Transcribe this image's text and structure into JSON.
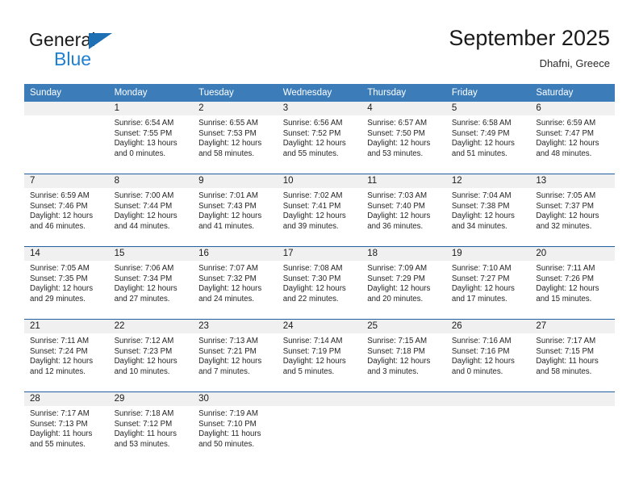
{
  "brand": {
    "name_top": "General",
    "name_bottom": "Blue",
    "triangle_color": "#1f6fb5",
    "blue_text_color": "#1f7fd0"
  },
  "header": {
    "title": "September 2025",
    "location": "Dhafni, Greece"
  },
  "theme": {
    "header_row_bg": "#3b7cb9",
    "grid_line": "#1f5f9e",
    "daynum_band_bg": "#f0f0f0",
    "page_bg": "#ffffff",
    "text": "#222222"
  },
  "weekdays": [
    "Sunday",
    "Monday",
    "Tuesday",
    "Wednesday",
    "Thursday",
    "Friday",
    "Saturday"
  ],
  "labels": {
    "sunrise_prefix": "Sunrise:",
    "sunset_prefix": "Sunset:",
    "daylight_prefix": "Daylight:"
  },
  "weeks": [
    [
      {
        "day": "",
        "lines": []
      },
      {
        "day": "1",
        "lines": [
          "Sunrise: 6:54 AM",
          "Sunset: 7:55 PM",
          "Daylight: 13 hours",
          "and 0 minutes."
        ]
      },
      {
        "day": "2",
        "lines": [
          "Sunrise: 6:55 AM",
          "Sunset: 7:53 PM",
          "Daylight: 12 hours",
          "and 58 minutes."
        ]
      },
      {
        "day": "3",
        "lines": [
          "Sunrise: 6:56 AM",
          "Sunset: 7:52 PM",
          "Daylight: 12 hours",
          "and 55 minutes."
        ]
      },
      {
        "day": "4",
        "lines": [
          "Sunrise: 6:57 AM",
          "Sunset: 7:50 PM",
          "Daylight: 12 hours",
          "and 53 minutes."
        ]
      },
      {
        "day": "5",
        "lines": [
          "Sunrise: 6:58 AM",
          "Sunset: 7:49 PM",
          "Daylight: 12 hours",
          "and 51 minutes."
        ]
      },
      {
        "day": "6",
        "lines": [
          "Sunrise: 6:59 AM",
          "Sunset: 7:47 PM",
          "Daylight: 12 hours",
          "and 48 minutes."
        ]
      }
    ],
    [
      {
        "day": "7",
        "lines": [
          "Sunrise: 6:59 AM",
          "Sunset: 7:46 PM",
          "Daylight: 12 hours",
          "and 46 minutes."
        ]
      },
      {
        "day": "8",
        "lines": [
          "Sunrise: 7:00 AM",
          "Sunset: 7:44 PM",
          "Daylight: 12 hours",
          "and 44 minutes."
        ]
      },
      {
        "day": "9",
        "lines": [
          "Sunrise: 7:01 AM",
          "Sunset: 7:43 PM",
          "Daylight: 12 hours",
          "and 41 minutes."
        ]
      },
      {
        "day": "10",
        "lines": [
          "Sunrise: 7:02 AM",
          "Sunset: 7:41 PM",
          "Daylight: 12 hours",
          "and 39 minutes."
        ]
      },
      {
        "day": "11",
        "lines": [
          "Sunrise: 7:03 AM",
          "Sunset: 7:40 PM",
          "Daylight: 12 hours",
          "and 36 minutes."
        ]
      },
      {
        "day": "12",
        "lines": [
          "Sunrise: 7:04 AM",
          "Sunset: 7:38 PM",
          "Daylight: 12 hours",
          "and 34 minutes."
        ]
      },
      {
        "day": "13",
        "lines": [
          "Sunrise: 7:05 AM",
          "Sunset: 7:37 PM",
          "Daylight: 12 hours",
          "and 32 minutes."
        ]
      }
    ],
    [
      {
        "day": "14",
        "lines": [
          "Sunrise: 7:05 AM",
          "Sunset: 7:35 PM",
          "Daylight: 12 hours",
          "and 29 minutes."
        ]
      },
      {
        "day": "15",
        "lines": [
          "Sunrise: 7:06 AM",
          "Sunset: 7:34 PM",
          "Daylight: 12 hours",
          "and 27 minutes."
        ]
      },
      {
        "day": "16",
        "lines": [
          "Sunrise: 7:07 AM",
          "Sunset: 7:32 PM",
          "Daylight: 12 hours",
          "and 24 minutes."
        ]
      },
      {
        "day": "17",
        "lines": [
          "Sunrise: 7:08 AM",
          "Sunset: 7:30 PM",
          "Daylight: 12 hours",
          "and 22 minutes."
        ]
      },
      {
        "day": "18",
        "lines": [
          "Sunrise: 7:09 AM",
          "Sunset: 7:29 PM",
          "Daylight: 12 hours",
          "and 20 minutes."
        ]
      },
      {
        "day": "19",
        "lines": [
          "Sunrise: 7:10 AM",
          "Sunset: 7:27 PM",
          "Daylight: 12 hours",
          "and 17 minutes."
        ]
      },
      {
        "day": "20",
        "lines": [
          "Sunrise: 7:11 AM",
          "Sunset: 7:26 PM",
          "Daylight: 12 hours",
          "and 15 minutes."
        ]
      }
    ],
    [
      {
        "day": "21",
        "lines": [
          "Sunrise: 7:11 AM",
          "Sunset: 7:24 PM",
          "Daylight: 12 hours",
          "and 12 minutes."
        ]
      },
      {
        "day": "22",
        "lines": [
          "Sunrise: 7:12 AM",
          "Sunset: 7:23 PM",
          "Daylight: 12 hours",
          "and 10 minutes."
        ]
      },
      {
        "day": "23",
        "lines": [
          "Sunrise: 7:13 AM",
          "Sunset: 7:21 PM",
          "Daylight: 12 hours",
          "and 7 minutes."
        ]
      },
      {
        "day": "24",
        "lines": [
          "Sunrise: 7:14 AM",
          "Sunset: 7:19 PM",
          "Daylight: 12 hours",
          "and 5 minutes."
        ]
      },
      {
        "day": "25",
        "lines": [
          "Sunrise: 7:15 AM",
          "Sunset: 7:18 PM",
          "Daylight: 12 hours",
          "and 3 minutes."
        ]
      },
      {
        "day": "26",
        "lines": [
          "Sunrise: 7:16 AM",
          "Sunset: 7:16 PM",
          "Daylight: 12 hours",
          "and 0 minutes."
        ]
      },
      {
        "day": "27",
        "lines": [
          "Sunrise: 7:17 AM",
          "Sunset: 7:15 PM",
          "Daylight: 11 hours",
          "and 58 minutes."
        ]
      }
    ],
    [
      {
        "day": "28",
        "lines": [
          "Sunrise: 7:17 AM",
          "Sunset: 7:13 PM",
          "Daylight: 11 hours",
          "and 55 minutes."
        ]
      },
      {
        "day": "29",
        "lines": [
          "Sunrise: 7:18 AM",
          "Sunset: 7:12 PM",
          "Daylight: 11 hours",
          "and 53 minutes."
        ]
      },
      {
        "day": "30",
        "lines": [
          "Sunrise: 7:19 AM",
          "Sunset: 7:10 PM",
          "Daylight: 11 hours",
          "and 50 minutes."
        ]
      },
      {
        "day": "",
        "lines": []
      },
      {
        "day": "",
        "lines": []
      },
      {
        "day": "",
        "lines": []
      },
      {
        "day": "",
        "lines": []
      }
    ]
  ]
}
